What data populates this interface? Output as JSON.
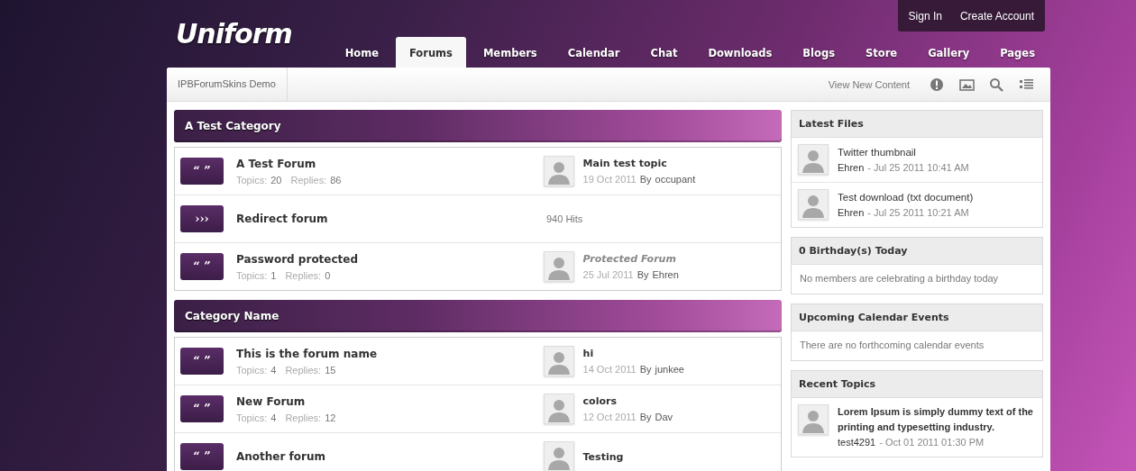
{
  "site": {
    "logo": "Uniform"
  },
  "user_links": [
    "Sign In",
    "Create Account"
  ],
  "nav": [
    {
      "label": "Home",
      "selected": false
    },
    {
      "label": "Forums",
      "selected": true
    },
    {
      "label": "Members",
      "selected": false
    },
    {
      "label": "Calendar",
      "selected": false
    },
    {
      "label": "Chat",
      "selected": false
    },
    {
      "label": "Downloads",
      "selected": false
    },
    {
      "label": "Blogs",
      "selected": false
    },
    {
      "label": "Store",
      "selected": false
    },
    {
      "label": "Gallery",
      "selected": false
    },
    {
      "label": "Pages",
      "selected": false
    }
  ],
  "breadcrumb": "IPBForumSkins Demo",
  "toolbar": {
    "view_new_content": "View New Content"
  },
  "categories": [
    {
      "title": "A Test Category",
      "forums": [
        {
          "kind": "forum",
          "marker": "“ ”",
          "name": "A Test Forum",
          "topics_label": "Topics:",
          "topics": "20",
          "replies_label": "Replies:",
          "replies": "86",
          "last_post": {
            "title": "Main test topic",
            "date": "19 Oct 2011",
            "by": "By",
            "author": "occupant"
          }
        },
        {
          "kind": "redirect",
          "marker": "›››",
          "name": "Redirect forum",
          "hits": "940 Hits"
        },
        {
          "kind": "protected",
          "marker": "“ ”",
          "name": "Password protected",
          "topics_label": "Topics:",
          "topics": "1",
          "replies_label": "Replies:",
          "replies": "0",
          "last_post": {
            "title": "Protected Forum",
            "date": "25 Jul 2011",
            "by": "By",
            "author": "Ehren"
          }
        }
      ]
    },
    {
      "title": "Category Name",
      "forums": [
        {
          "kind": "forum",
          "marker": "“ ”",
          "name": "This is the forum name",
          "topics_label": "Topics:",
          "topics": "4",
          "replies_label": "Replies:",
          "replies": "15",
          "last_post": {
            "title": "hi",
            "date": "14 Oct 2011",
            "by": "By",
            "author": "junkee"
          }
        },
        {
          "kind": "forum",
          "marker": "“ ”",
          "name": "New Forum",
          "topics_label": "Topics:",
          "topics": "4",
          "replies_label": "Replies:",
          "replies": "12",
          "last_post": {
            "title": "colors",
            "date": "12 Oct 2011",
            "by": "By",
            "author": "Dav"
          }
        },
        {
          "kind": "forum",
          "marker": "“ ”",
          "name": "Another forum",
          "last_post": {
            "title": "Testing"
          }
        }
      ]
    }
  ],
  "sidebar": [
    {
      "kind": "files",
      "title": "Latest Files",
      "items": [
        {
          "title": "Twitter thumbnail",
          "author": "Ehren",
          "date": "- Jul 25 2011 10:41 AM"
        },
        {
          "title": "Test download (txt document)",
          "author": "Ehren",
          "date": "- Jul 25 2011 10:21 AM"
        }
      ]
    },
    {
      "kind": "message",
      "title": "0 Birthday(s) Today",
      "message": "No members are celebrating a birthday today"
    },
    {
      "kind": "message",
      "title": "Upcoming Calendar Events",
      "message": "There are no forthcoming calendar events"
    },
    {
      "kind": "topics",
      "title": "Recent Topics",
      "items": [
        {
          "title": "Lorem Ipsum is simply dummy text of the printing and typesetting industry.",
          "author": "test4291",
          "date": "- Oct 01 2011 01:30 PM"
        }
      ]
    }
  ]
}
